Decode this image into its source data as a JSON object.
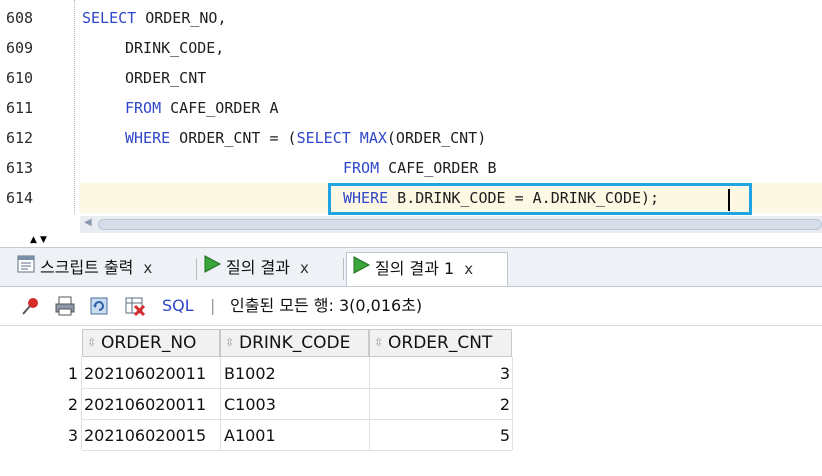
{
  "editor": {
    "lines": [
      {
        "num": "608",
        "indent": 82,
        "parts": [
          [
            "kw",
            "SELECT"
          ],
          [
            "t",
            " ORDER_NO,"
          ]
        ]
      },
      {
        "num": "609",
        "indent": 125,
        "parts": [
          [
            "t",
            "DRINK_CODE,"
          ]
        ]
      },
      {
        "num": "610",
        "indent": 125,
        "parts": [
          [
            "t",
            "ORDER_CNT"
          ]
        ]
      },
      {
        "num": "611",
        "indent": 125,
        "parts": [
          [
            "kw",
            "FROM"
          ],
          [
            "t",
            " CAFE_ORDER A"
          ]
        ]
      },
      {
        "num": "612",
        "indent": 125,
        "parts": [
          [
            "kw",
            "WHERE"
          ],
          [
            "t",
            " ORDER_CNT = ("
          ],
          [
            "kw",
            "SELECT MAX"
          ],
          [
            "t",
            "(ORDER_CNT)"
          ]
        ]
      },
      {
        "num": "613",
        "indent": 343,
        "parts": [
          [
            "kw",
            "FROM"
          ],
          [
            "t",
            " CAFE_ORDER B"
          ]
        ]
      },
      {
        "num": "614",
        "indent": 343,
        "parts": [
          [
            "kw",
            "WHERE"
          ],
          [
            "t",
            " B.DRINK_CODE = A.DRINK_CODE);"
          ]
        ]
      }
    ],
    "current_line_index": 6
  },
  "tabs": [
    {
      "label": "스크립트 출력",
      "icon": "script-output-icon",
      "close": "x",
      "active": false
    },
    {
      "label": "질의 결과",
      "icon": "run-query-icon",
      "close": "x",
      "active": false
    },
    {
      "label": "질의 결과 1",
      "icon": "run-query-icon",
      "close": "x",
      "active": true
    }
  ],
  "toolbar": {
    "sql_label": "SQL",
    "separator": "|",
    "status": "인출된 모든 행: 3(0,016초)"
  },
  "grid": {
    "columns": [
      "ORDER_NO",
      "DRINK_CODE",
      "ORDER_CNT"
    ],
    "rows": [
      {
        "n": "1",
        "order_no": "202106020011",
        "drink_code": "B1002",
        "order_cnt": "3"
      },
      {
        "n": "2",
        "order_no": "202106020011",
        "drink_code": "C1003",
        "order_cnt": "2"
      },
      {
        "n": "3",
        "order_no": "202106020015",
        "drink_code": "A1001",
        "order_cnt": "5"
      }
    ]
  },
  "colors": {
    "keyword": "#2f47c9",
    "current_line": "#fdf8e4",
    "selection_box": "#1ea3e3"
  }
}
